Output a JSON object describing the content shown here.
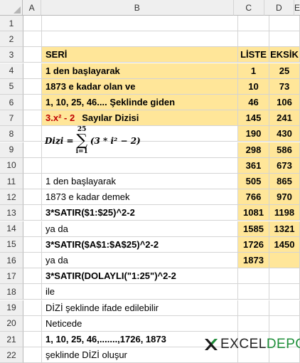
{
  "columns": [
    "A",
    "B",
    "C",
    "D",
    "E"
  ],
  "rows": [
    {
      "n": "1",
      "b": "",
      "c": "",
      "d": ""
    },
    {
      "n": "2",
      "b": "",
      "c": "",
      "d": ""
    },
    {
      "n": "3",
      "b": "SERİ",
      "c": "LİSTE",
      "d": "EKSİK"
    },
    {
      "n": "4",
      "b": "1 den başlayarak",
      "c": "1",
      "d": "25"
    },
    {
      "n": "5",
      "b": "1873  e kadar olan ve",
      "c": "10",
      "d": "73"
    },
    {
      "n": "6",
      "b": "1, 10, 25, 46.... Şeklinde giden",
      "c": "46",
      "d": "106"
    },
    {
      "n": "7",
      "b": "",
      "c": "145",
      "d": "241"
    },
    {
      "n": "8",
      "b": "",
      "c": "190",
      "d": "430"
    },
    {
      "n": "9",
      "b": "",
      "c": "298",
      "d": "586"
    },
    {
      "n": "10",
      "b": "",
      "c": "361",
      "d": "673"
    },
    {
      "n": "11",
      "b": "1 den başlayarak",
      "c": "505",
      "d": "865"
    },
    {
      "n": "12",
      "b": "1873  e kadar  demek",
      "c": "766",
      "d": "970"
    },
    {
      "n": "13",
      "b": "3*SATIR($1:$25)^2-2",
      "c": "1081",
      "d": "1198"
    },
    {
      "n": "14",
      "b": "ya da",
      "c": "1585",
      "d": "1321"
    },
    {
      "n": "15",
      "b": "3*SATIR($A$1:$A$25)^2-2",
      "c": "1726",
      "d": "1450"
    },
    {
      "n": "16",
      "b": "ya da",
      "c": "1873",
      "d": ""
    },
    {
      "n": "17",
      "b": "3*SATIR(DOLAYLI(\"1:25\")^2-2",
      "c": "",
      "d": ""
    },
    {
      "n": "18",
      "b": "ile",
      "c": "",
      "d": ""
    },
    {
      "n": "19",
      "b": "DİZİ şeklinde ifade edilebilir",
      "c": "",
      "d": ""
    },
    {
      "n": "20",
      "b": "Neticede",
      "c": "",
      "d": ""
    },
    {
      "n": "21",
      "b": "1, 10, 25, 46,.......,1726, 1873",
      "c": "",
      "d": ""
    },
    {
      "n": "22",
      "b": "şeklinde  DİZİ oluşur",
      "c": "",
      "d": ""
    }
  ],
  "row7": {
    "formula_red": "3.x² - 2",
    "label": "Sayılar Dizisi"
  },
  "math": {
    "lhs": "Dizi =",
    "sigma": "∑",
    "upper": "25",
    "lower": "i=1",
    "body": "(3 * i² − 2)"
  },
  "logo": {
    "part1": "EXCEL",
    "part2": "DEPO"
  },
  "colors": {
    "highlight": "#ffe699",
    "accent_red": "#c00000",
    "logo_green": "#1f8f3a"
  }
}
